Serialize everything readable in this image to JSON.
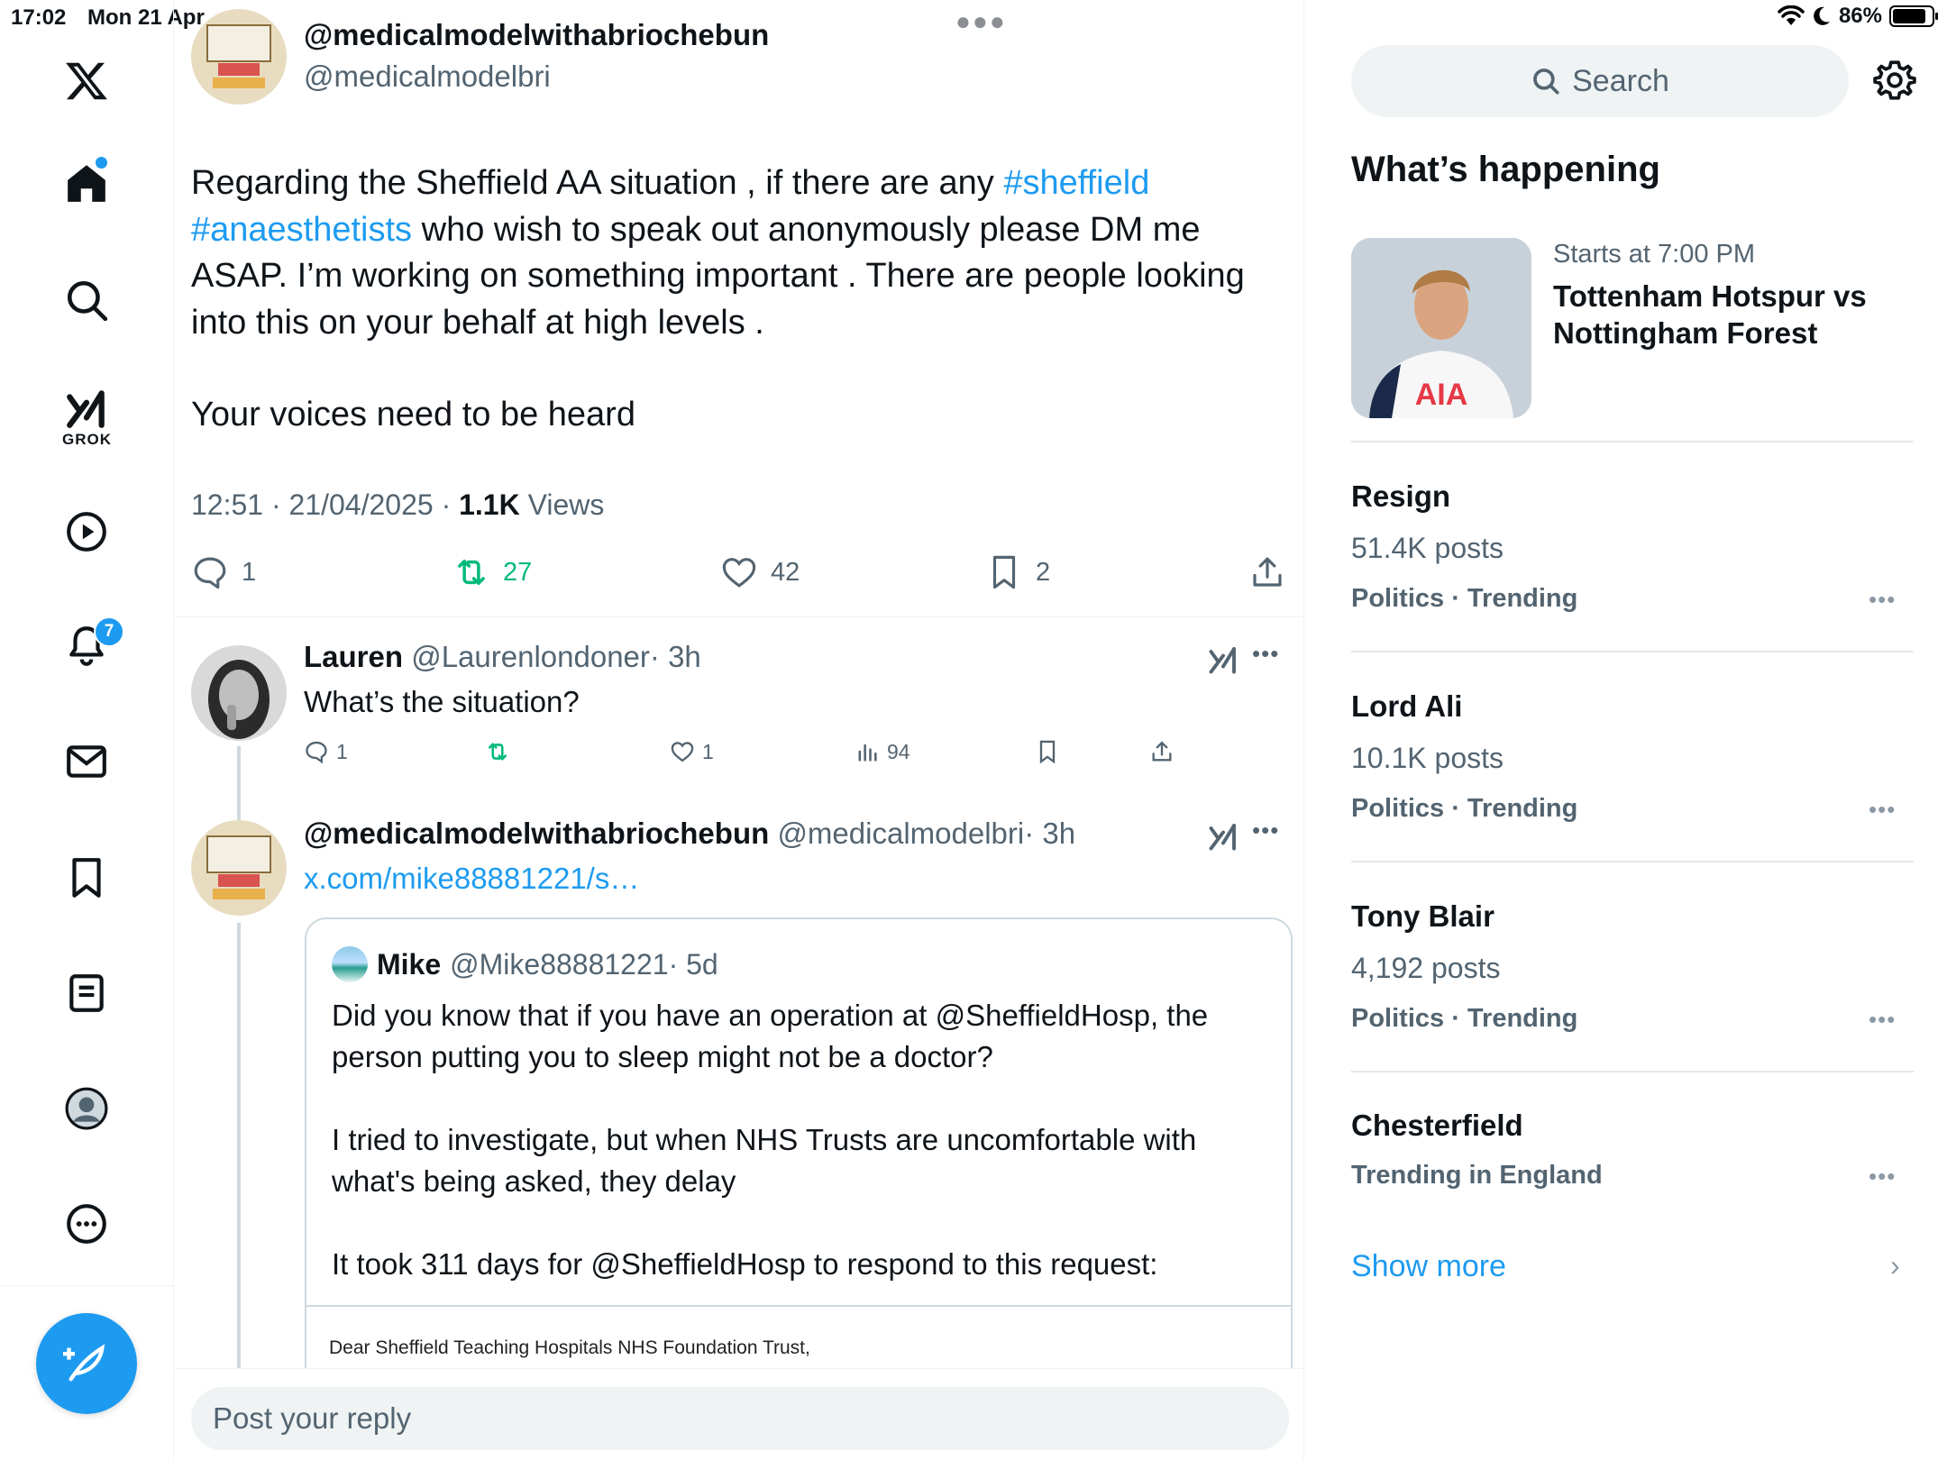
{
  "status_bar": {
    "time": "17:02",
    "date": "Mon 21 Apr",
    "battery": "86%",
    "battery_level": 0.86
  },
  "nav": {
    "grok_label": "GROK",
    "notifications_badge": "7"
  },
  "tweet": {
    "author_name": "@medicalmodelwithabriochebun",
    "author_handle": "@medicalmodelbri",
    "text_p1_a": "Regarding the Sheffield AA situation , if there are any ",
    "hashtag1": "#sheffield",
    "hashtag2": "#anaesthetists",
    "text_p1_b": " who wish to speak out anonymously please DM me ASAP. I’m working on something important . There are people looking into this on your behalf at high levels .",
    "text_p2": "Your voices need to be heard",
    "time": "12:51 · 21/04/2025 · ",
    "views_count": "1.1K",
    "views_label": " Views",
    "replies": "1",
    "reposts": "27",
    "likes": "42",
    "bookmarks": "2"
  },
  "reply1": {
    "name": "Lauren",
    "handle": "@Laurenlondoner",
    "time": "· 3h",
    "text": "What’s the situation?",
    "replies": "1",
    "likes": "1",
    "views": "94"
  },
  "reply2": {
    "name": "@medicalmodelwithabriochebun",
    "handle": "@medicalmodelbri",
    "time": "· 3h",
    "link": "x.com/mike88881221/s…",
    "quote": {
      "name": "Mike",
      "handle": "@Mike88881221",
      "time": "· 5d",
      "p1": "Did you know that if you have an operation at @SheffieldHosp, the person putting you to sleep might not be a doctor?",
      "p2": "I tried to investigate, but when NHS Trusts are uncomfortable with what's being asked, they delay",
      "p3": "It took 311 days for @SheffieldHosp to respond to this request:",
      "image_text": "Dear Sheffield Teaching Hospitals NHS Foundation Trust,"
    }
  },
  "reply_box": {
    "placeholder": "Post your reply"
  },
  "sidebar": {
    "search_placeholder": "Search",
    "title": "What’s happening",
    "event": {
      "time": "Starts at 7:00 PM",
      "title": "Tottenham Hotspur vs Nottingham Forest",
      "shirt_text": "AIA"
    },
    "trends": [
      {
        "name": "Resign",
        "count": "51.4K posts",
        "context": "Politics · Trending"
      },
      {
        "name": "Lord Ali",
        "count": "10.1K posts",
        "context": "Politics · Trending"
      },
      {
        "name": "Tony Blair",
        "count": "4,192 posts",
        "context": "Politics · Trending"
      },
      {
        "name": "Chesterfield",
        "context": "Trending in England"
      }
    ],
    "show_more": "Show more"
  },
  "colors": {
    "accent": "#1d9bf0",
    "repost_green": "#00ba7c",
    "muted": "#536471",
    "text": "#0f1419"
  }
}
